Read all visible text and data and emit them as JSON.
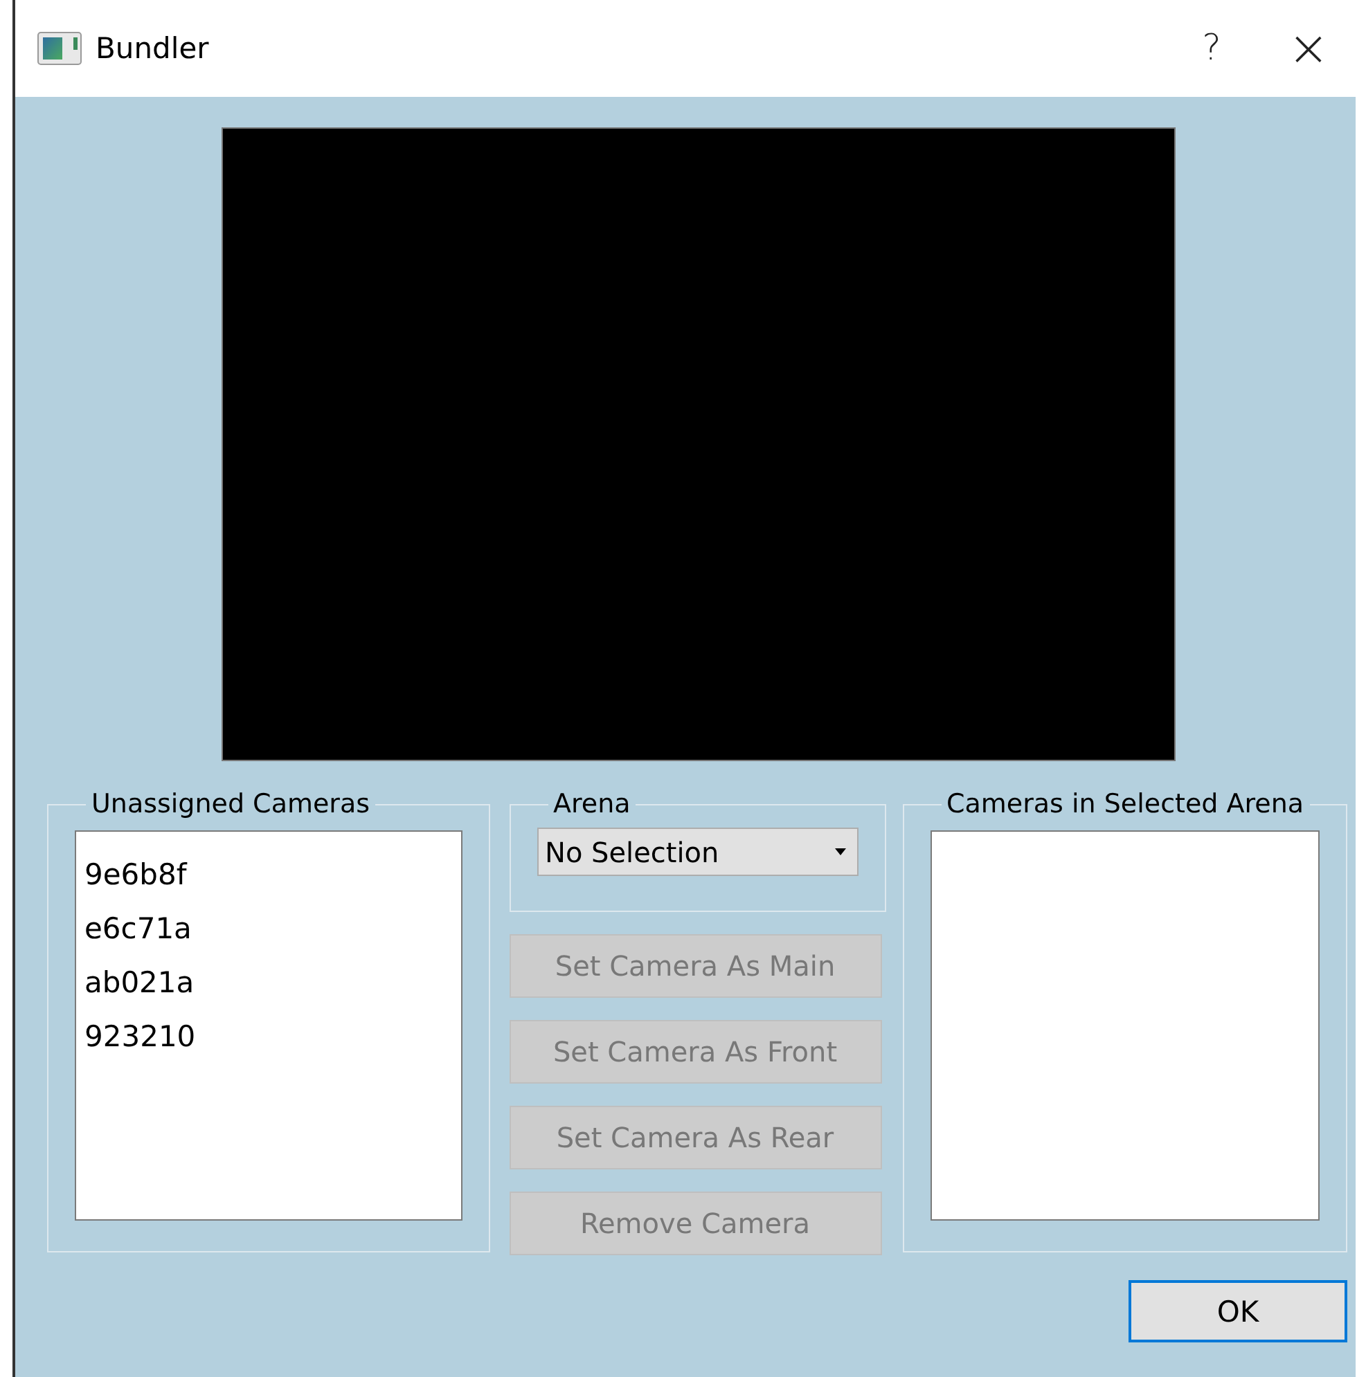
{
  "window": {
    "title": "Bundler",
    "help": "?",
    "close": "×"
  },
  "unassigned": {
    "title": "Unassigned Cameras",
    "items": [
      "9e6b8f",
      "e6c71a",
      "ab021a",
      "923210"
    ]
  },
  "arena": {
    "title": "Arena",
    "value": "No Selection"
  },
  "actions": [
    {
      "label": "Set Camera As Main",
      "disabled": true
    },
    {
      "label": "Set Camera As Front",
      "disabled": true
    },
    {
      "label": "Set Camera As Rear",
      "disabled": true
    },
    {
      "label": "Remove Camera",
      "disabled": true
    }
  ],
  "selected_arena": {
    "title": "Cameras in Selected Arena"
  },
  "buttons": [
    {
      "label": "OK",
      "focused": true
    }
  ]
}
